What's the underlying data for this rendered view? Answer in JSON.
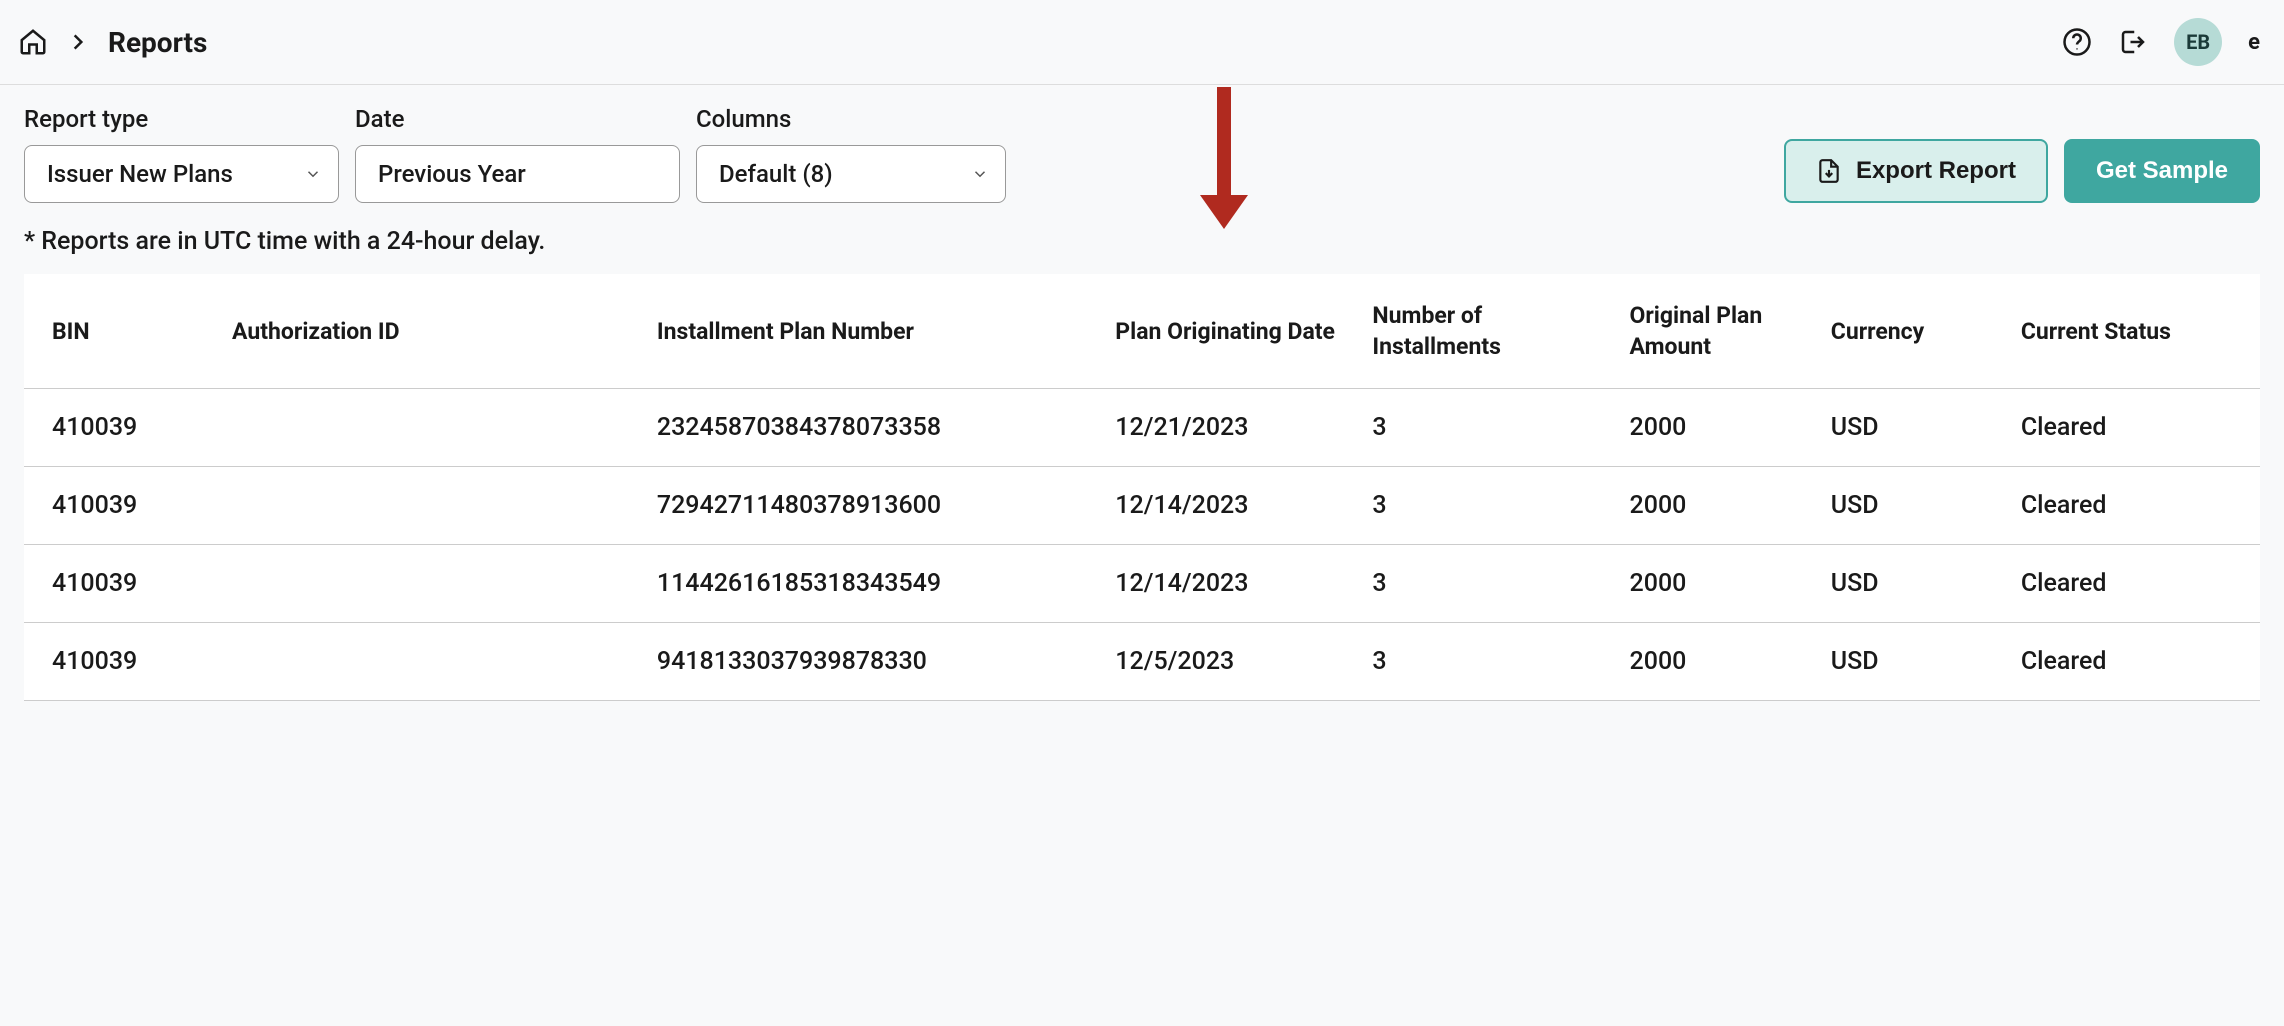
{
  "header": {
    "title": "Reports",
    "avatar_initials": "EB",
    "avatar_extra": "e"
  },
  "filters": {
    "report_type": {
      "label": "Report type",
      "value": "Issuer New Plans"
    },
    "date": {
      "label": "Date",
      "value": "Previous Year"
    },
    "columns": {
      "label": "Columns",
      "value": "Default (8)"
    }
  },
  "actions": {
    "export": "Export Report",
    "sample": "Get Sample"
  },
  "note": "* Reports are in UTC time with a 24-hour delay.",
  "table": {
    "headers": {
      "bin": "BIN",
      "auth": "Authorization ID",
      "plan": "Installment Plan Number",
      "date": "Plan Originating Date",
      "num": "Number of Installments",
      "amount": "Original Plan Amount",
      "currency": "Currency",
      "status": "Current Status"
    },
    "rows": [
      {
        "bin": "410039",
        "auth": "",
        "plan": "23245870384378073358",
        "date": "12/21/2023",
        "num": "3",
        "amount": "2000",
        "currency": "USD",
        "status": "Cleared"
      },
      {
        "bin": "410039",
        "auth": "",
        "plan": "72942711480378913600",
        "date": "12/14/2023",
        "num": "3",
        "amount": "2000",
        "currency": "USD",
        "status": "Cleared"
      },
      {
        "bin": "410039",
        "auth": "",
        "plan": "11442616185318343549",
        "date": "12/14/2023",
        "num": "3",
        "amount": "2000",
        "currency": "USD",
        "status": "Cleared"
      },
      {
        "bin": "410039",
        "auth": "",
        "plan": "9418133037939878330",
        "date": "12/5/2023",
        "num": "3",
        "amount": "2000",
        "currency": "USD",
        "status": "Cleared"
      }
    ]
  }
}
